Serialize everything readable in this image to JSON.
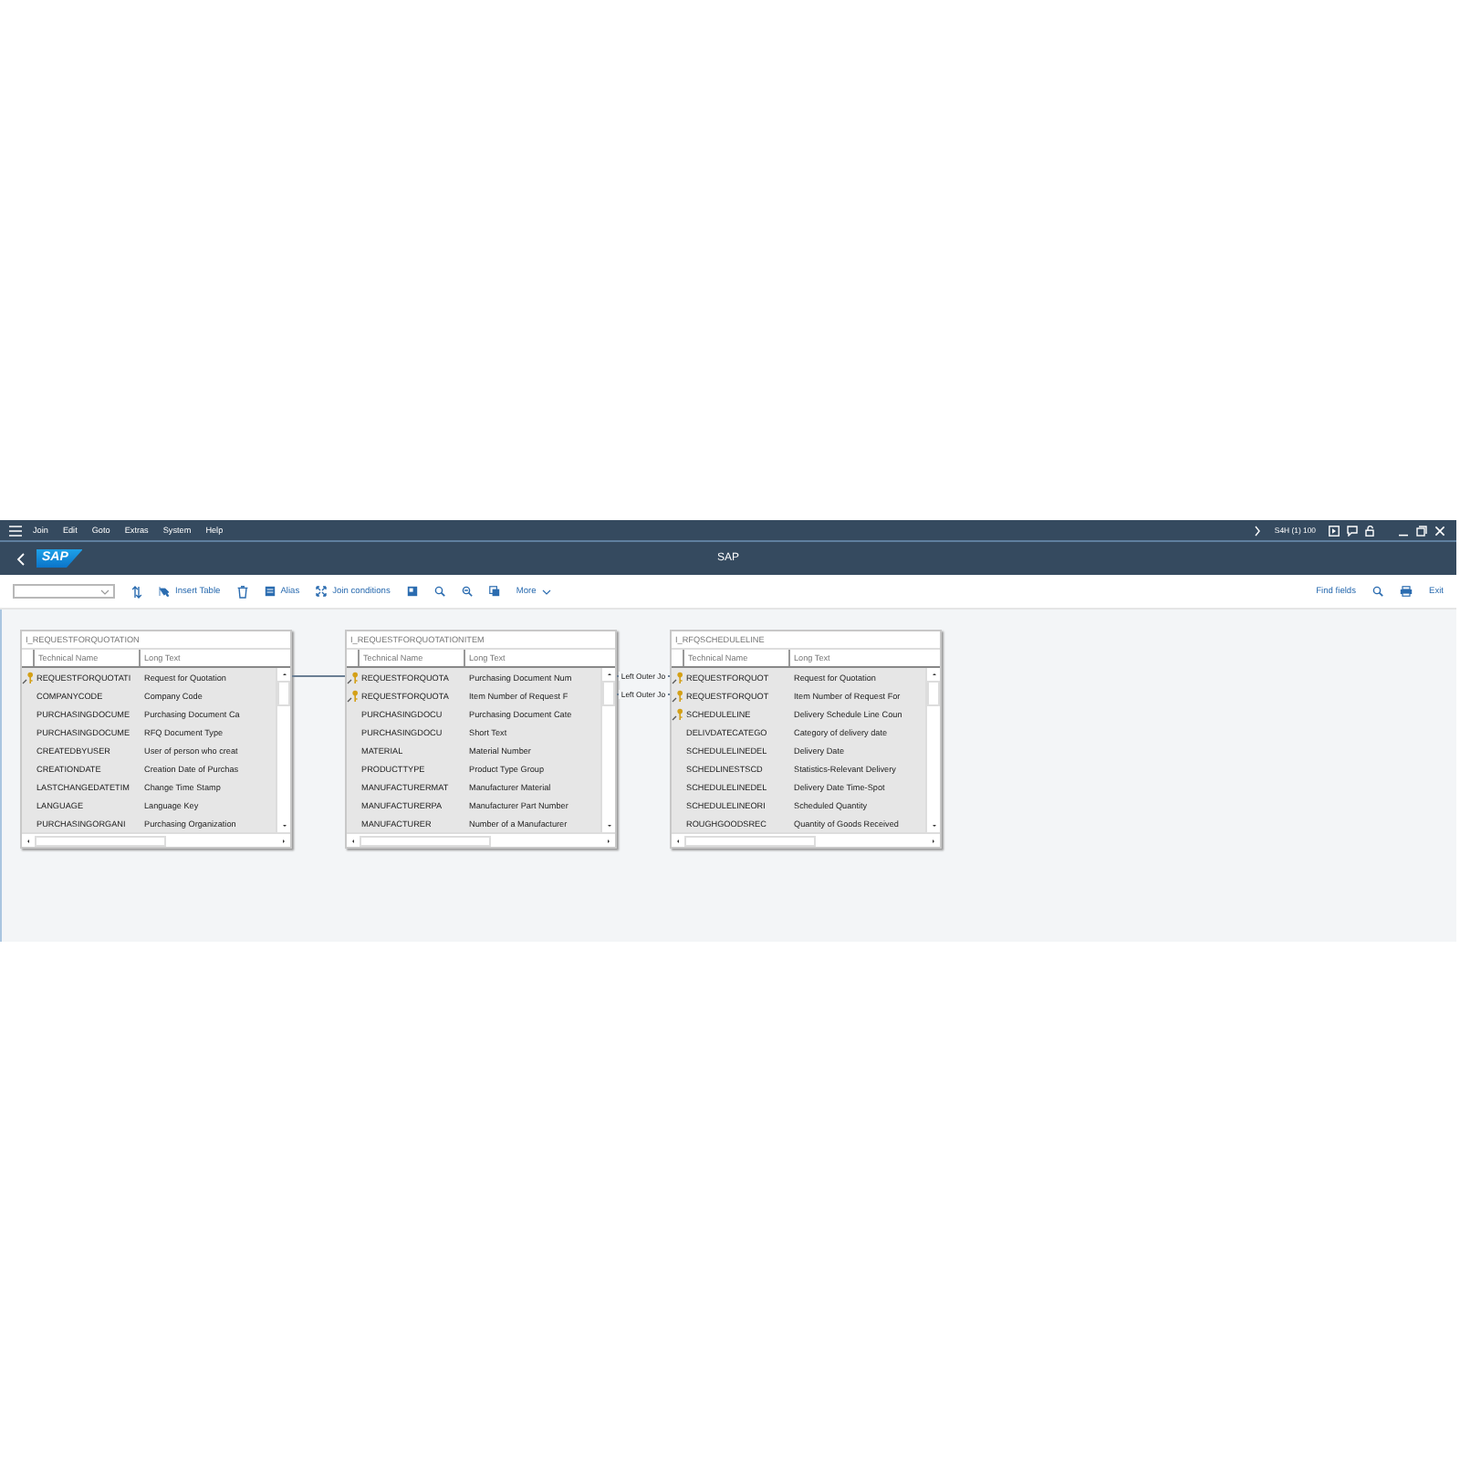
{
  "menu": [
    "Join",
    "Edit",
    "Goto",
    "Extras",
    "System",
    "Help"
  ],
  "system_info": "S4H (1) 100",
  "title": "SAP",
  "logo": "SAP",
  "toolbar": {
    "insert": "Insert Table",
    "alias": "Alias",
    "join": "Join conditions",
    "more": "More",
    "find": "Find fields",
    "exit": "Exit"
  },
  "tables": [
    {
      "name": "I_REQUESTFORQUOTATION",
      "columns": [
        "Technical Name",
        "Long Text"
      ],
      "joins_right": [
        {
          "kind": "line"
        }
      ],
      "rows": [
        {
          "technical_name": "REQUESTFORQUOTATI",
          "long_text": "Request for Quotation",
          "key": true
        },
        {
          "technical_name": "COMPANYCODE",
          "long_text": "Company Code",
          "key": false
        },
        {
          "technical_name": "PURCHASINGDOCUME",
          "long_text": "Purchasing Document Ca",
          "key": false
        },
        {
          "technical_name": "PURCHASINGDOCUME",
          "long_text": "RFQ Document Type",
          "key": false
        },
        {
          "technical_name": "CREATEDBYUSER",
          "long_text": "User of person who creat",
          "key": false
        },
        {
          "technical_name": "CREATIONDATE",
          "long_text": "Creation Date of Purchas",
          "key": false
        },
        {
          "technical_name": "LASTCHANGEDATETIM",
          "long_text": "Change Time Stamp",
          "key": false
        },
        {
          "technical_name": "LANGUAGE",
          "long_text": "Language Key",
          "key": false
        },
        {
          "technical_name": "PURCHASINGORGANI",
          "long_text": "Purchasing Organization",
          "key": false
        }
      ]
    },
    {
      "name": "I_REQUESTFORQUOTATIONITEM",
      "columns": [
        "Technical Name",
        "Long Text"
      ],
      "joins_right": [
        {
          "kind": "labeled",
          "label": "Left Outer Jo"
        },
        {
          "kind": "labeled",
          "label": "Left Outer Jo"
        }
      ],
      "rows": [
        {
          "technical_name": "REQUESTFORQUOTA",
          "long_text": "Purchasing Document Num",
          "key": true
        },
        {
          "technical_name": "REQUESTFORQUOTA",
          "long_text": "Item Number of Request F",
          "key": true
        },
        {
          "technical_name": "PURCHASINGDOCU",
          "long_text": "Purchasing Document Cate",
          "key": false
        },
        {
          "technical_name": "PURCHASINGDOCU",
          "long_text": "Short Text",
          "key": false
        },
        {
          "technical_name": "MATERIAL",
          "long_text": "Material Number",
          "key": false
        },
        {
          "technical_name": "PRODUCTTYPE",
          "long_text": "Product Type Group",
          "key": false
        },
        {
          "technical_name": "MANUFACTURERMAT",
          "long_text": "Manufacturer Material",
          "key": false
        },
        {
          "technical_name": "MANUFACTURERPA",
          "long_text": "Manufacturer Part Number",
          "key": false
        },
        {
          "technical_name": "MANUFACTURER",
          "long_text": "Number of a Manufacturer",
          "key": false
        }
      ]
    },
    {
      "name": "I_RFQSCHEDULELINE",
      "columns": [
        "Technical Name",
        "Long Text"
      ],
      "rows": [
        {
          "technical_name": "REQUESTFORQUOT",
          "long_text": "Request for Quotation",
          "key": true
        },
        {
          "technical_name": "REQUESTFORQUOT",
          "long_text": "Item Number of Request For",
          "key": true
        },
        {
          "technical_name": "SCHEDULELINE",
          "long_text": "Delivery Schedule Line Coun",
          "key": true
        },
        {
          "technical_name": "DELIVDATECATEGO",
          "long_text": "Category of delivery date",
          "key": false
        },
        {
          "technical_name": "SCHEDULELINEDEL",
          "long_text": "Delivery Date",
          "key": false
        },
        {
          "technical_name": "SCHEDLINESTSCD",
          "long_text": "Statistics-Relevant Delivery",
          "key": false
        },
        {
          "technical_name": "SCHEDULELINEDEL",
          "long_text": "Delivery Date Time-Spot",
          "key": false
        },
        {
          "technical_name": "SCHEDULELINEORI",
          "long_text": "Scheduled Quantity",
          "key": false
        },
        {
          "technical_name": "ROUGHGOODSREC",
          "long_text": "Quantity of Goods Received",
          "key": false
        }
      ]
    }
  ]
}
